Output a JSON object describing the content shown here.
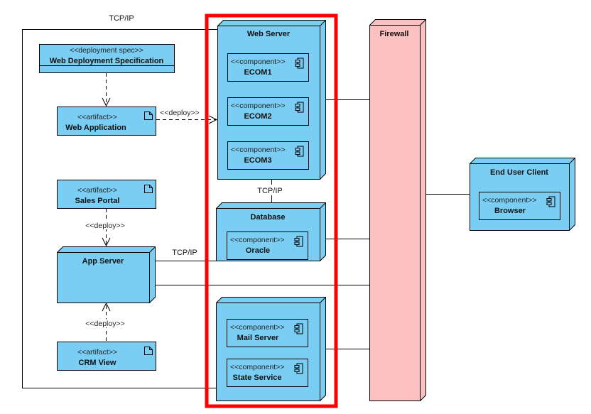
{
  "diagram": {
    "connectors": {
      "tcpip_top": "TCP/IP",
      "tcpip_webdb": "TCP/IP",
      "tcpip_app": "TCP/IP",
      "deploy_webapp": "<<deploy>>",
      "deploy_sales": "<<deploy>>",
      "deploy_crm": "<<deploy>>"
    },
    "deployment_spec": {
      "stereotype": "<<deployment spec>>",
      "name": "Web Deployment Specification"
    },
    "artifacts": [
      {
        "stereotype": "<<artifact>>",
        "name": "Web Application"
      },
      {
        "stereotype": "<<artifact>>",
        "name": "Sales Portal"
      },
      {
        "stereotype": "<<artifact>>",
        "name": "CRM View"
      }
    ],
    "nodes": {
      "app_server": "App Server",
      "web_server": "Web Server",
      "database": "Database",
      "firewall": "Firewall",
      "end_user_client": "End User Client"
    },
    "components": {
      "stereotype": "<<component>>",
      "ecom1": "ECOM1",
      "ecom2": "ECOM2",
      "ecom3": "ECOM3",
      "oracle": "Oracle",
      "mail_server": "Mail Server",
      "state_service": "State Service",
      "browser": "Browser"
    },
    "colors": {
      "node": "#7ACDF3",
      "firewall": "#FDC0C0",
      "highlight": "#FF0000"
    }
  }
}
